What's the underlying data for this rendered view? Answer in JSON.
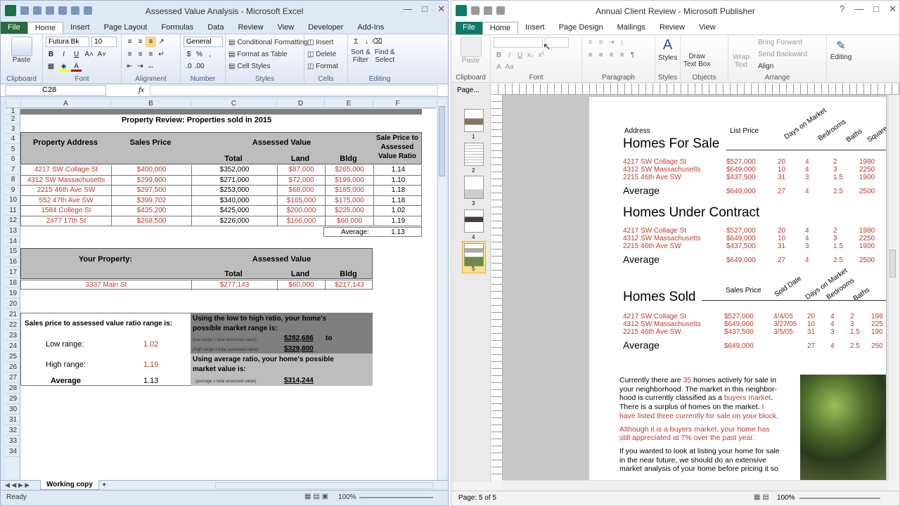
{
  "excel": {
    "title": "Assessed Value Analysis - Microsoft Excel",
    "tabs": [
      "File",
      "Home",
      "Insert",
      "Page Layout",
      "Formulas",
      "Data",
      "Review",
      "View",
      "Developer",
      "Add-Ins"
    ],
    "ribbon": {
      "paste": "Paste",
      "font_name": "Futura Bk",
      "font_size": "10",
      "number_format": "General",
      "conditional": "Conditional Formatting",
      "format_table": "Format as Table",
      "cell_styles": "Cell Styles",
      "insert": "Insert",
      "delete": "Delete",
      "format": "Format",
      "sort_filter_1": "Sort &",
      "sort_filter_2": "Filter",
      "find_select_1": "Find &",
      "find_select_2": "Select",
      "groups": [
        "Clipboard",
        "Font",
        "Alignment",
        "Number",
        "Styles",
        "Cells",
        "Editing"
      ]
    },
    "name_box": "C28",
    "fx": "fx",
    "columns": [
      "A",
      "B",
      "C",
      "D",
      "E",
      "F"
    ],
    "rows": [
      "1",
      "2",
      "3",
      "4",
      "5",
      "6",
      "7",
      "8",
      "9",
      "10",
      "11",
      "12",
      "13",
      "14",
      "15",
      "16",
      "17",
      "18",
      "19",
      "20",
      "21",
      "22",
      "23",
      "24",
      "25",
      "26",
      "27",
      "28",
      "29",
      "30",
      "31",
      "32",
      "33",
      "34"
    ],
    "sheet": {
      "title": "Property Review: Properties sold in 2015",
      "h_address": "Property Address",
      "h_sales": "Sales Price",
      "h_assessed": "Assessed Value",
      "h_ratio": "Sale Price to Assessed Value Ratio",
      "h_total": "Total",
      "h_land": "Land",
      "h_bldg": "Bldg",
      "rows": [
        {
          "addr": "4217 SW Collage St",
          "price": "$400,000",
          "total": "$352,000",
          "land": "$87,000",
          "bldg": "$265,000",
          "ratio": "1.14"
        },
        {
          "addr": "4312 SW Massachusetts",
          "price": "$299,000",
          "total": "$271,000",
          "land": "$72,000",
          "bldg": "$199,000",
          "ratio": "1.10"
        },
        {
          "addr": "2215 46th Ave SW",
          "price": "$297,500",
          "total": "$253,000",
          "land": "$68,000",
          "bldg": "$185,000",
          "ratio": "1.18"
        },
        {
          "addr": "552 47th Ave SW",
          "price": "$399,702",
          "total": "$340,000",
          "land": "$165,000",
          "bldg": "$175,000",
          "ratio": "1.18"
        },
        {
          "addr": "1584 College St",
          "price": "$435,200",
          "total": "$425,000",
          "land": "$200,000",
          "bldg": "$225,000",
          "ratio": "1.02"
        },
        {
          "addr": "2477 17th St",
          "price": "$268,500",
          "total": "$226,000",
          "land": "$166,000",
          "bldg": "$60,000",
          "ratio": "1.19"
        }
      ],
      "average_label": "Average:",
      "average_value": "1.13",
      "your_property": "Your Property:",
      "your_addr": "3337 Main St",
      "your_total": "$277,143",
      "your_land": "$60,000",
      "your_bldg": "$217,143",
      "range_title": "Sales price to assessed value ratio range is:",
      "low_label": "Low range:",
      "low_value": "1.02",
      "high_label": "High range:",
      "high_value": "1.19",
      "avg_label": "Average",
      "avg_value": "1.13",
      "low_high_text_1": "Using the low to high ratio, your home's",
      "low_high_text_2": "possible market range is:",
      "low_formula": "(low range x total assessed value)",
      "low_amount": "$282,686",
      "to": "to",
      "high_formula": "(high range x total assessed value)",
      "high_amount": "$329,800",
      "avg_text_1": "Using average ratio, your home's possible",
      "avg_text_2": "market value is:",
      "avg_formula": "(average x total assessed value)",
      "avg_amount": "$314,244"
    },
    "sheet_tab": "Working copy",
    "status": "Ready",
    "zoom": "100%"
  },
  "publisher": {
    "title": "Annual Client Review - Microsoft Publisher",
    "tabs": [
      "File",
      "Home",
      "Insert",
      "Page Design",
      "Mailings",
      "Review",
      "View"
    ],
    "ribbon": {
      "paste": "Paste",
      "styles": "Styles",
      "draw_textbox_1": "Draw",
      "draw_textbox_2": "Text Box",
      "wrap_text_1": "Wrap",
      "wrap_text_2": "Text",
      "bring_forward": "Bring Forward",
      "send_backward": "Send Backward",
      "align": "Align",
      "editing": "Editing",
      "groups": [
        "Clipboard",
        "Font",
        "Paragraph",
        "Styles",
        "Objects",
        "Arrange"
      ]
    },
    "pages_label": "Page...",
    "pages": [
      "1",
      "2",
      "3",
      "4",
      "5"
    ],
    "doc": {
      "col_address": "Address",
      "col_list_price": "List Price",
      "col_days": "Days on Market",
      "col_bedrooms": "Bedrooms",
      "col_baths": "Baths",
      "col_square": "Square",
      "col_sales_price": "Sales Price",
      "col_sold_date": "Sold Date",
      "for_sale": "Homes For Sale",
      "under_contract": "Homes Under Contract",
      "sold": "Homes Sold",
      "average": "Average",
      "listings": [
        {
          "addr": "4217 SW Collage St",
          "price": "$527,000",
          "days": "20",
          "beds": "4",
          "baths": "2",
          "sq": "1980",
          "date": "4/4/05"
        },
        {
          "addr": "4312 SW Massachusetts",
          "price": "$649,000",
          "days": "10",
          "beds": "4",
          "baths": "3",
          "sq": "2250",
          "date": "3/27/05"
        },
        {
          "addr": "2215 46th Ave SW",
          "price": "$437,500",
          "days": "31",
          "beds": "3",
          "baths": "1.5",
          "sq": "1900",
          "date": "3/5/05"
        }
      ],
      "avg_row": {
        "price": "$649,000",
        "days": "27",
        "beds": "4",
        "baths": "2.5",
        "sq": "2500"
      },
      "sold_sq": [
        "198",
        "225",
        "190"
      ],
      "sold_avg_sq": "250",
      "para1_a": "Currently there are ",
      "para1_num": "35",
      "para1_b": " homes actively for sale in",
      "para1_c": "your neighborhood. The market in this neighbor-",
      "para1_d": "hood is currently classified as a ",
      "para1_buyers": "buyers market",
      "para1_e": ".",
      "para1_f": "There is a surplus of homes on the market. ",
      "para1_g": "I",
      "para1_h": "have listed three currently for sale on your block.",
      "para2_a": "Although it is a buyers market, your home has",
      "para2_b": "still appreciated at 7% over the past year.",
      "para3_a": "If you wanted to look at listing your home for sale",
      "para3_b": "in the near future, we should do an extensive",
      "para3_c": "market analysis of your home before pricing it so"
    },
    "status_page": "Page: 5 of 5",
    "zoom": "100%"
  }
}
